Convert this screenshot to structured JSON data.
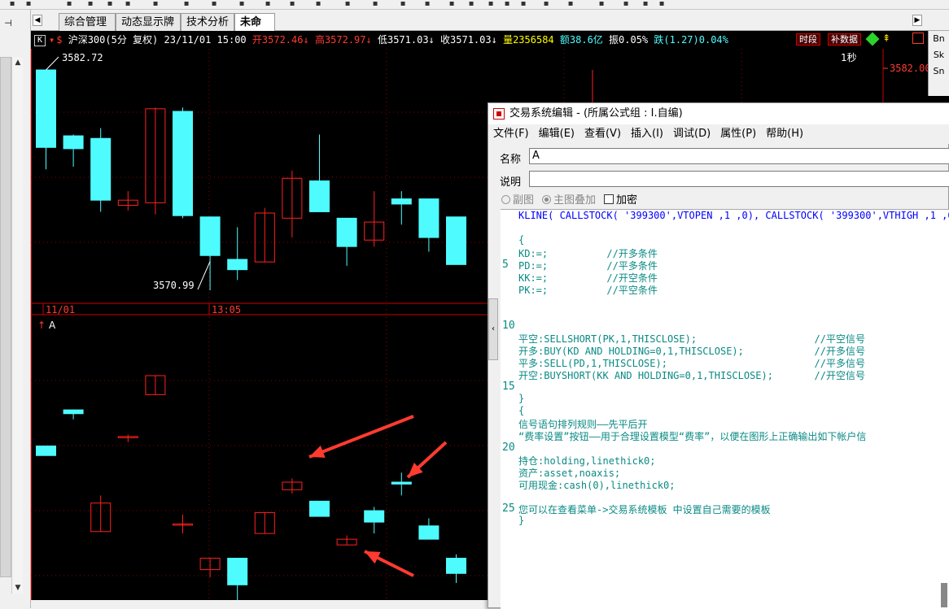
{
  "tabs": [
    {
      "label": "综合管理",
      "active": false
    },
    {
      "label": "动态显示牌",
      "active": false
    },
    {
      "label": "技术分析",
      "active": false
    },
    {
      "label": "未命名",
      "active": true
    }
  ],
  "info": {
    "period_badge": "K",
    "symbol": "沪深300(5分 复权) 23/11/01 15:00",
    "open": "开3572.46↓",
    "high": "高3572.97↓",
    "low": "低3571.03↓",
    "close": "收3571.03↓",
    "volume": "量2356584",
    "amount": "额38.6亿",
    "amplitude": "振0.05%",
    "change": "跌(1.27)0.04%",
    "btn_period": "时段",
    "btn_supplement": "补数据"
  },
  "chart": {
    "high_label": "3582.72",
    "low_label": "3570.99",
    "right_price": "3582.00",
    "interval": "1秒",
    "date_label": "11/01",
    "time_label": "13:05",
    "sub_name": "A"
  },
  "chart_data": {
    "type": "candlestick",
    "main_candles": [
      {
        "o": 3582.72,
        "c": 3576.7,
        "h": 3582.72,
        "l": 3575.0
      },
      {
        "o": 3577.6,
        "c": 3576.6,
        "h": 3577.7,
        "l": 3575.2
      },
      {
        "o": 3577.4,
        "c": 3572.6,
        "h": 3578.2,
        "l": 3571.7
      },
      {
        "o": 3572.2,
        "c": 3572.6,
        "h": 3573.3,
        "l": 3571.8
      },
      {
        "o": 3572.4,
        "c": 3579.7,
        "h": 3579.8,
        "l": 3571.5
      },
      {
        "o": 3579.5,
        "c": 3571.4,
        "h": 3579.8,
        "l": 3571.2
      },
      {
        "o": 3571.3,
        "c": 3568.3,
        "h": 3571.3,
        "l": 3565.6
      },
      {
        "o": 3568.0,
        "c": 3567.2,
        "h": 3570.5,
        "l": 3566.4
      },
      {
        "o": 3567.8,
        "c": 3571.6,
        "h": 3572.0,
        "l": 3567.8
      },
      {
        "o": 3571.2,
        "c": 3574.3,
        "h": 3574.9,
        "l": 3569.7
      },
      {
        "o": 3574.1,
        "c": 3571.7,
        "h": 3577.7,
        "l": 3571.7
      },
      {
        "o": 3571.2,
        "c": 3569.0,
        "h": 3571.2,
        "l": 3567.5
      },
      {
        "o": 3569.5,
        "c": 3570.9,
        "h": 3573.3,
        "l": 3569.0
      },
      {
        "o": 3572.7,
        "c": 3572.3,
        "h": 3573.3,
        "l": 3570.7
      },
      {
        "o": 3572.7,
        "c": 3569.7,
        "h": 3572.7,
        "l": 3568.6
      },
      {
        "o": 3571.3,
        "c": 3567.6,
        "h": 3571.3,
        "l": 3567.6
      }
    ],
    "sub_candles": [
      {
        "o": 55,
        "c": 50,
        "h": 55,
        "l": 50
      },
      {
        "o": 74,
        "c": 72,
        "h": 74,
        "l": 69
      },
      {
        "o": 10,
        "c": 25,
        "h": 29,
        "l": 10
      },
      {
        "o": 60,
        "c": 60,
        "h": 61,
        "l": 57
      },
      {
        "o": 82,
        "c": 92,
        "h": 92,
        "l": 82
      },
      {
        "o": 14,
        "c": 14,
        "h": 19,
        "l": 9
      },
      {
        "o": -10,
        "c": -4,
        "h": -4,
        "l": -14
      },
      {
        "o": -4,
        "c": -18,
        "h": -4,
        "l": -26
      },
      {
        "o": 9,
        "c": 20,
        "h": 20,
        "l": 9
      },
      {
        "o": 32,
        "c": 36,
        "h": 38,
        "l": 30
      },
      {
        "o": 26,
        "c": 18,
        "h": 26,
        "l": 18
      },
      {
        "o": 3,
        "c": 6,
        "h": 8,
        "l": 3
      },
      {
        "o": 21,
        "c": 15,
        "h": 23,
        "l": 9
      },
      {
        "o": 36,
        "c": 35,
        "h": 41,
        "l": 29
      },
      {
        "o": 13,
        "c": 6,
        "h": 17,
        "l": 6
      },
      {
        "o": -4,
        "c": -12,
        "h": -2,
        "l": -17
      }
    ]
  },
  "editor": {
    "title": "交易系统编辑 - (所属公式组 : I.自编)",
    "menu": [
      "文件(F)",
      "编辑(E)",
      "查看(V)",
      "插入(I)",
      "调试(D)",
      "属性(P)",
      "帮助(H)"
    ],
    "name_label": "名称",
    "name_value": "A",
    "desc_label": "说明",
    "desc_value": "",
    "radio_sub": "副图",
    "radio_main": "主图叠加",
    "check_overlay": "加密",
    "code_first_line": "KLINE( CALLSTOCK( '399300',VTOPEN ,1 ,0), CALLSTOCK( '399300',VTHIGH ,1 ,0),",
    "code_lines": [
      "",
      "{",
      "KD:=;          //开多条件",
      "PD:=;          //平多条件",
      "KK:=;          //开空条件",
      "PK:=;          //平空条件",
      "",
      "",
      "",
      "平空:SELLSHORT(PK,1,THISCLOSE);                    //平空信号",
      "开多:BUY(KD AND HOLDING=0,1,THISCLOSE);            //开多信号",
      "平多:SELL(PD,1,THISCLOSE);                         //平多信号",
      "开空:BUYSHORT(KK AND HOLDING=0,1,THISCLOSE);       //开空信号",
      "",
      "}",
      "{",
      "信号语句排列规则——先平后开",
      "“费率设置”按钮——用于合理设置模型“费率”，以便在图形上正确输出如下帐户信",
      "",
      "持仓:holding,linethick0;",
      "资产:asset,noaxis;",
      "可用现金:cash(0),linethick0;",
      "",
      "您可以在查看菜单->交易系统模板 中设置自己需要的模板",
      "}"
    ],
    "gutter": [
      "5",
      "10",
      "15",
      "20",
      "25"
    ]
  },
  "right_tools": [
    "Bn",
    "Sk",
    "Sn"
  ],
  "colors": {
    "up": "#ff2020",
    "down": "#4efcff",
    "red": "#ff3b30",
    "code": "#0a8a84"
  }
}
